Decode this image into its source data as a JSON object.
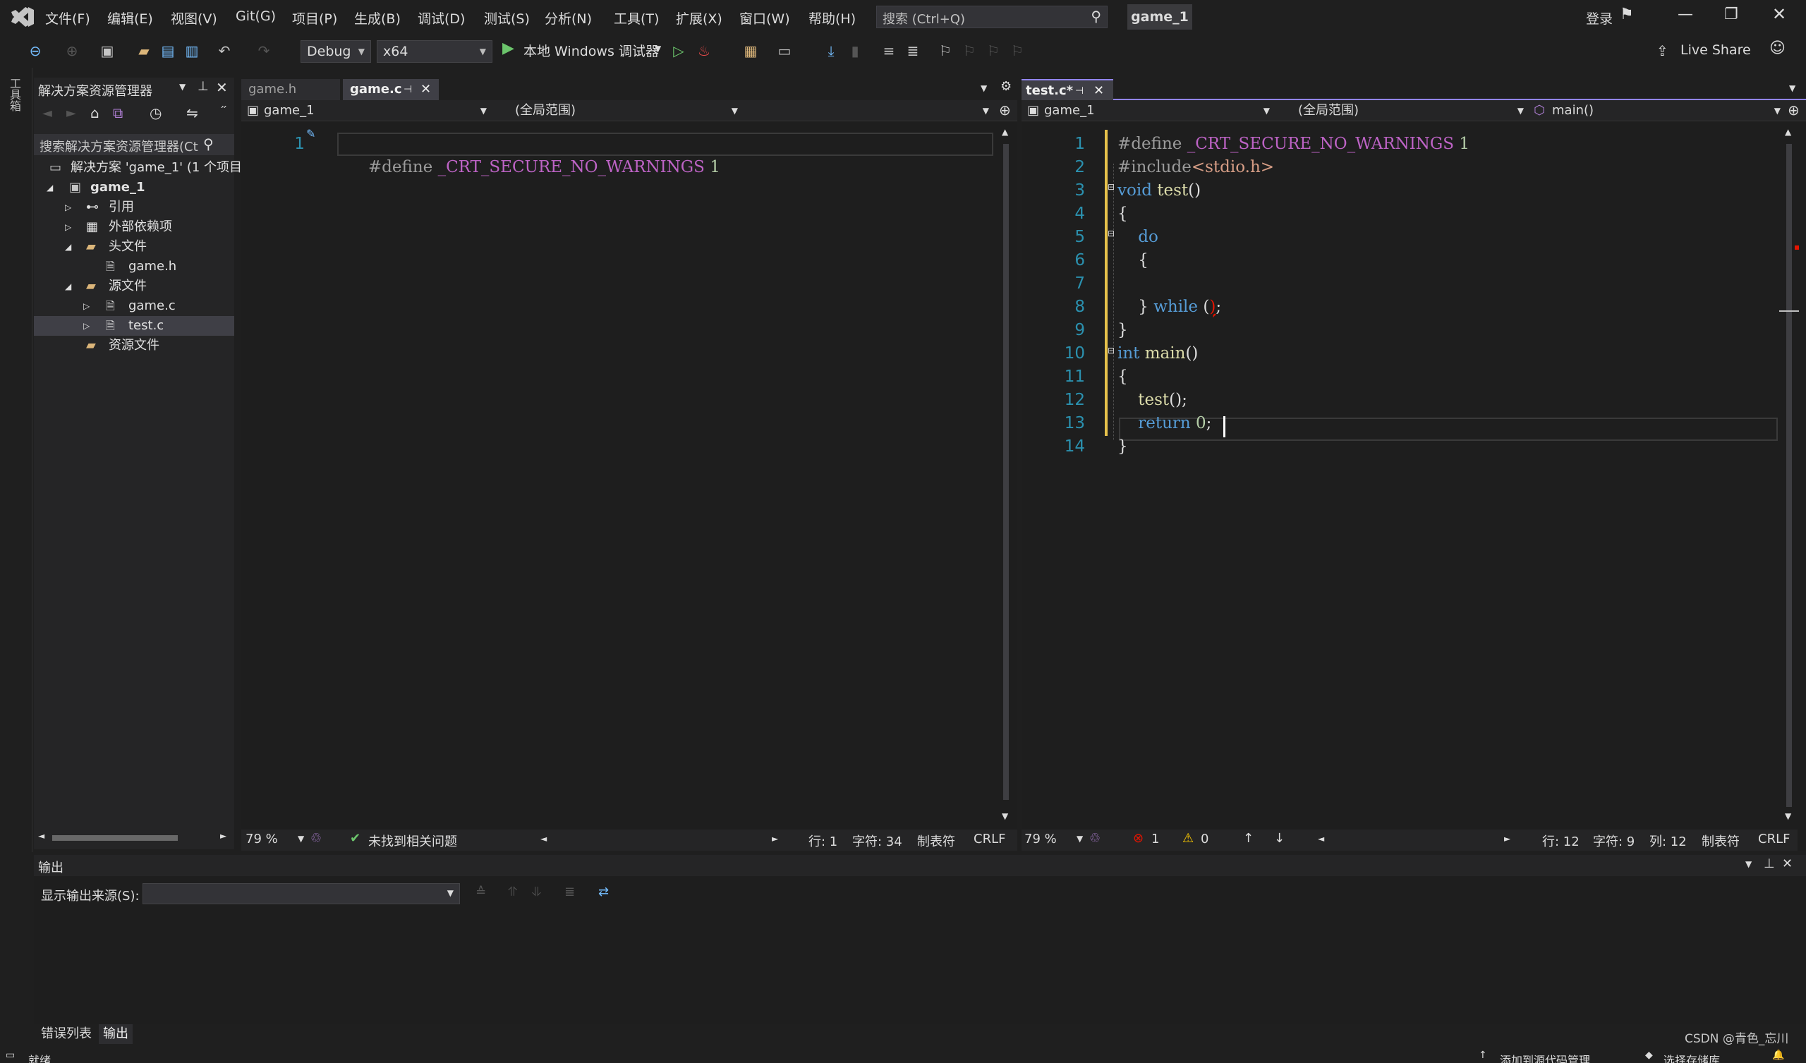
{
  "menu": [
    "文件(F)",
    "编辑(E)",
    "视图(V)",
    "Git(G)",
    "项目(P)",
    "生成(B)",
    "调试(D)",
    "测试(S)",
    "分析(N)",
    "工具(T)",
    "扩展(X)",
    "窗口(W)",
    "帮助(H)"
  ],
  "search": {
    "placeholder": "搜索 (Ctrl+Q)"
  },
  "solution_name": "game_1",
  "login": "登录",
  "live_share": "Live Share",
  "toolbar": {
    "config": "Debug",
    "platform": "x64",
    "run_label": "本地 Windows 调试器"
  },
  "side_strip_label": "工具箱",
  "solution_explorer": {
    "title": "解决方案资源管理器",
    "search": "搜索解决方案资源管理器(Ct",
    "items": [
      {
        "label": "解决方案 'game_1' (1 个项目"
      },
      {
        "label": "game_1"
      },
      {
        "label": "引用"
      },
      {
        "label": "外部依赖项"
      },
      {
        "label": "头文件"
      },
      {
        "label": "game.h"
      },
      {
        "label": "源文件"
      },
      {
        "label": "game.c"
      },
      {
        "label": "test.c"
      },
      {
        "label": "资源文件"
      }
    ]
  },
  "left_editor": {
    "tabs": [
      "game.h",
      "game.c"
    ],
    "nav": [
      "game_1",
      "(全局范围)",
      ""
    ],
    "line_numbers": [
      "1"
    ],
    "lines": [
      "#define _CRT_SECURE_NO_WARNINGS 1"
    ],
    "zoom": "79 %",
    "issues": "未找到相关问题",
    "row": "行: 1",
    "char": "字符: 34",
    "tab": "制表符",
    "eol": "CRLF"
  },
  "right_editor": {
    "tabs": [
      "test.c*"
    ],
    "nav": [
      "game_1",
      "(全局范围)",
      "main()"
    ],
    "line_numbers": [
      "1",
      "2",
      "3",
      "4",
      "5",
      "6",
      "7",
      "8",
      "9",
      "10",
      "11",
      "12",
      "13",
      "14"
    ],
    "zoom": "79 %",
    "errors": "1",
    "warnings": "0",
    "row": "行: 12",
    "char": "字符: 9",
    "col": "列: 12",
    "tab": "制表符",
    "eol": "CRLF"
  },
  "output": {
    "title": "输出",
    "source_label": "显示输出来源(S):",
    "tabs": [
      "错误列表",
      "输出"
    ]
  },
  "footer": {
    "watermark": "CSDN @青色_忘川",
    "status_left": "就绪",
    "status_right1": "添加到源代码管理",
    "status_right2": "选择存储库"
  },
  "colors": {
    "accent": "#9184ee",
    "bg": "#1e1e1e",
    "line_number": "#2b91af",
    "keyword": "#569cd6",
    "error": "#e51400"
  }
}
